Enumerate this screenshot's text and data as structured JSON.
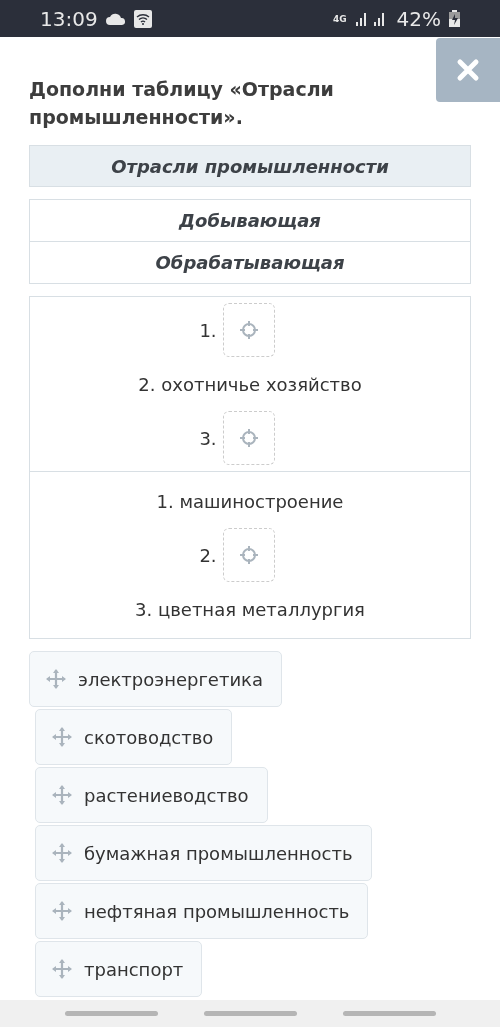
{
  "status_bar": {
    "time": "13:09",
    "network": "4G",
    "battery": "42%"
  },
  "question": "Дополни таблицу «Отрасли промышленности».",
  "header": "Отрасли промышленности",
  "categories": [
    "Добывающая",
    "Обрабатывающая"
  ],
  "answer_groups": [
    {
      "items": [
        {
          "kind": "slot",
          "number": "1."
        },
        {
          "kind": "text",
          "text": "2. охотничье хозяйство"
        },
        {
          "kind": "slot",
          "number": "3."
        }
      ]
    },
    {
      "items": [
        {
          "kind": "text",
          "text": "1. машиностроение"
        },
        {
          "kind": "slot",
          "number": "2."
        },
        {
          "kind": "text",
          "text": "3. цветная металлургия"
        }
      ]
    }
  ],
  "options": [
    "электроэнергетика",
    "скотоводство",
    "растениеводство",
    "бумажная промышленность",
    "нефтяная промышленность",
    "транспорт"
  ]
}
